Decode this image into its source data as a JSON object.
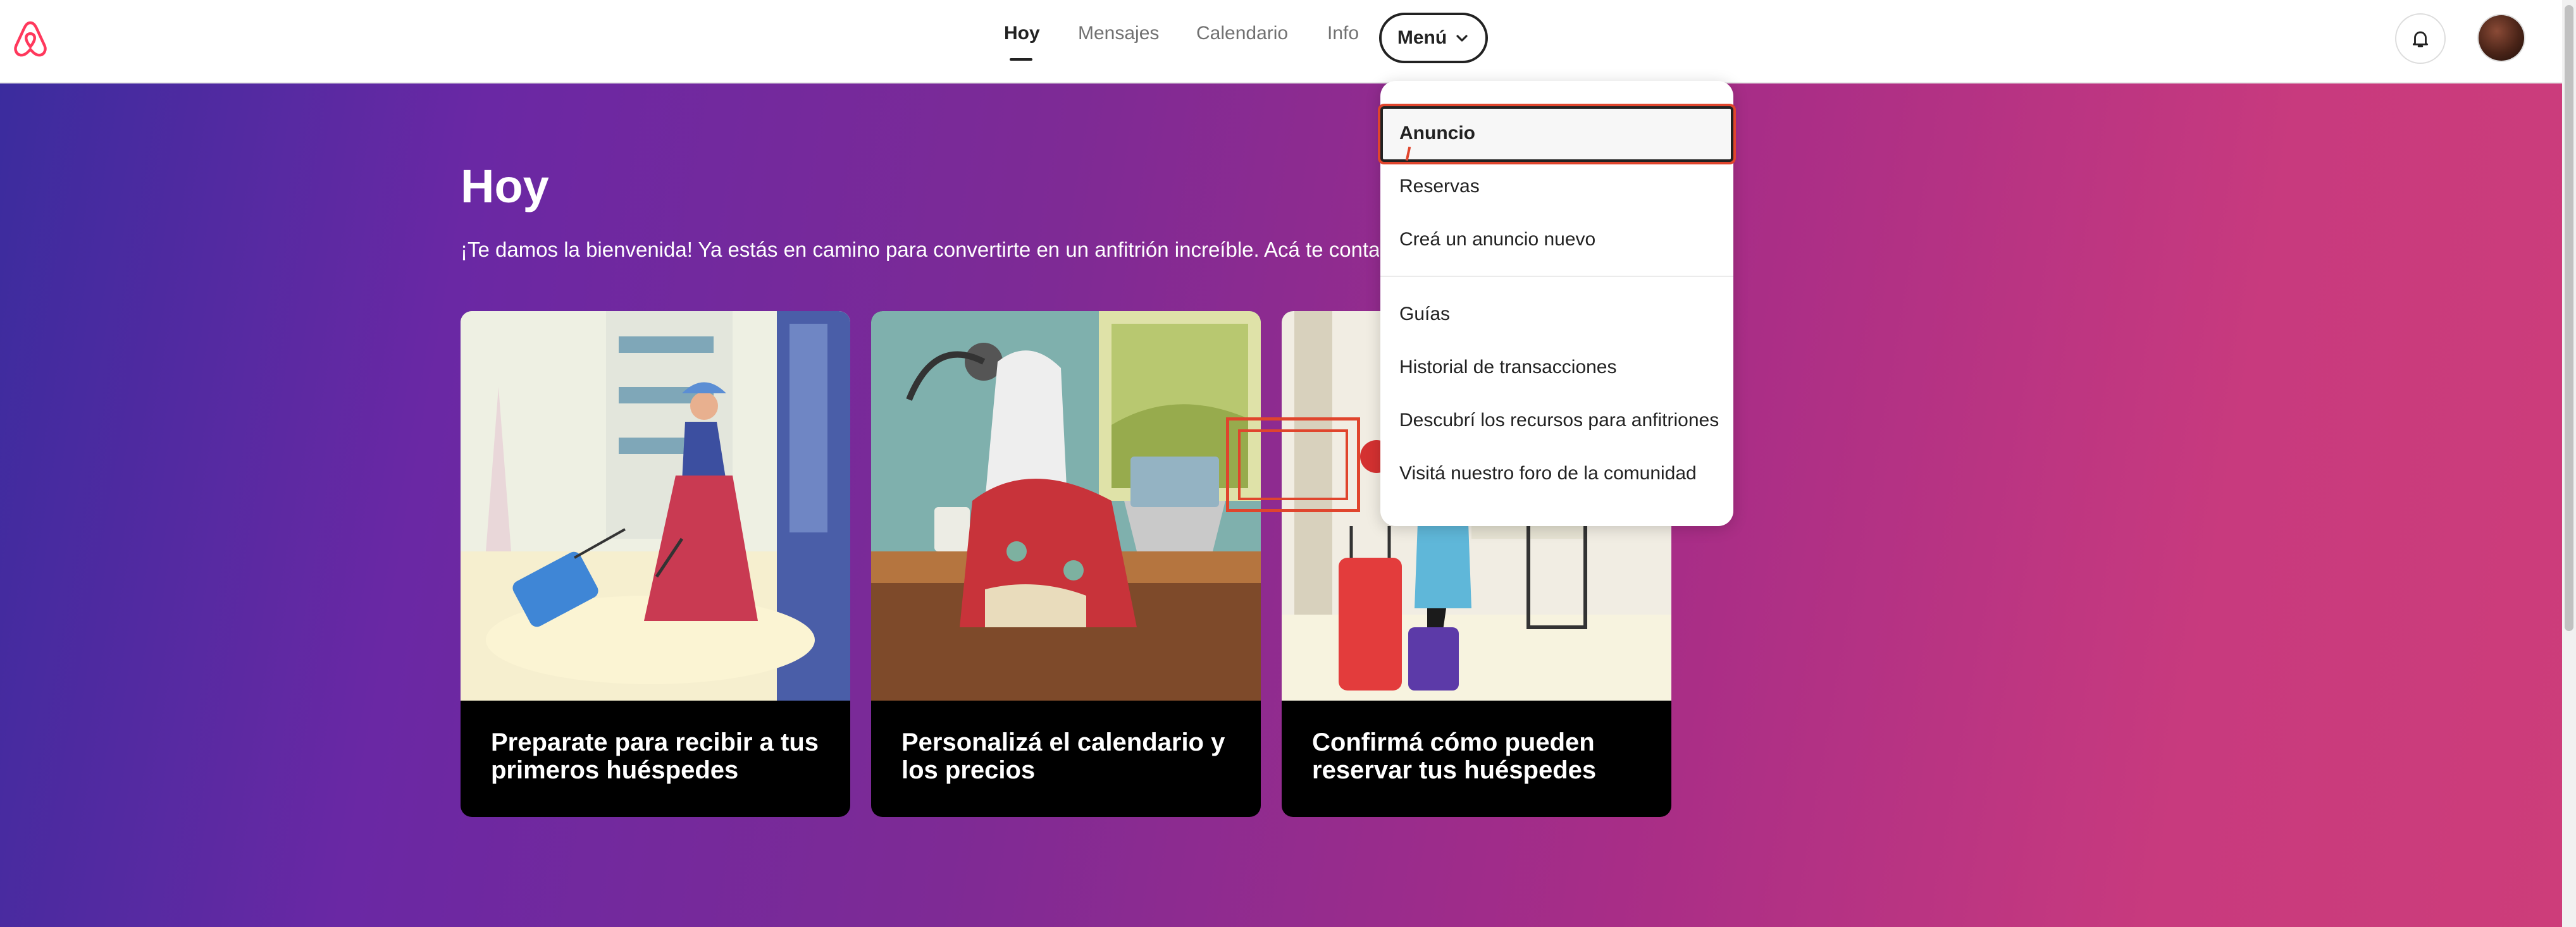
{
  "nav": {
    "tabs": [
      "Hoy",
      "Mensajes",
      "Calendario",
      "Info"
    ],
    "menu_label": "Menú"
  },
  "colors": {
    "brand": "#ff385c",
    "highlight_outline": "#e0452d",
    "hero_start": "#3b2c9e",
    "hero_end": "#cd3d7a"
  },
  "hero": {
    "title": "Hoy",
    "subtitle": "¡Te damos la bienvenida! Ya estás en camino para convertirte en un anfitrión increíble. Acá te contam"
  },
  "cards": [
    {
      "title": "Preparate para recibir a tus primeros huéspedes"
    },
    {
      "title": "Personalizá el calendario y los precios"
    },
    {
      "title": "Confirmá cómo pueden reservar tus huéspedes"
    }
  ],
  "menu": {
    "group1": [
      "Anuncio",
      "Reservas",
      "Creá un anuncio nuevo"
    ],
    "group2": [
      "Guías",
      "Historial de transacciones",
      "Descubrí los recursos para anfitriones",
      "Visitá nuestro foro de la comunidad"
    ]
  },
  "icons": {
    "logo": "airbnb-logo-icon",
    "menu_chevron": "chevron-down-icon",
    "notifications": "bell-icon"
  }
}
